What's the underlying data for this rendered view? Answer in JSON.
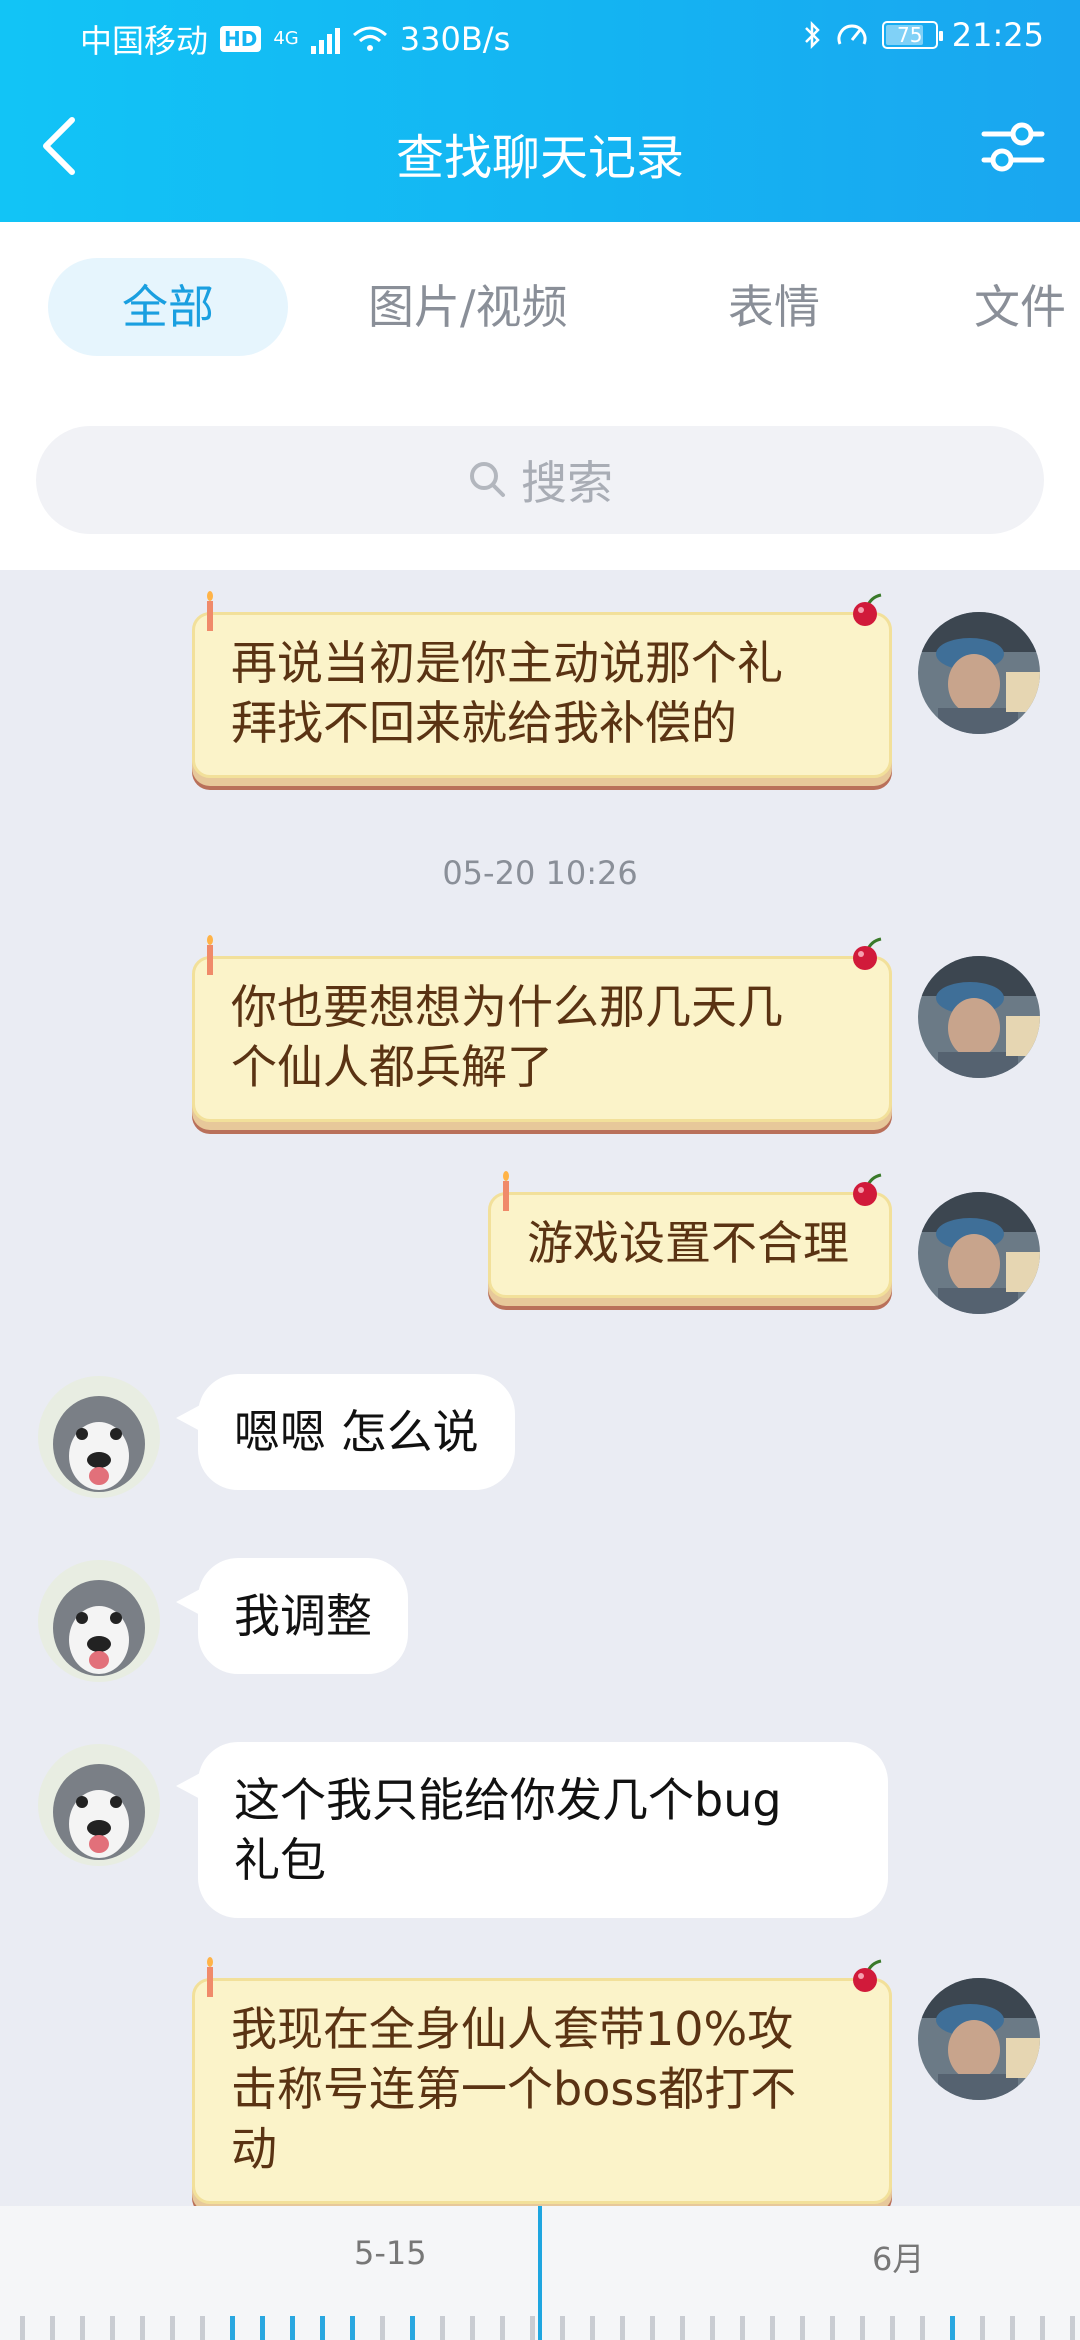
{
  "status_bar": {
    "carrier": "中国移动",
    "hd_badge": "HD",
    "network": "4G",
    "speed": "330B/s",
    "battery": "75",
    "time": "21:25"
  },
  "header": {
    "title": "查找聊天记录",
    "back_icon": "chevron-left-icon",
    "settings_icon": "sliders-icon"
  },
  "tabs": [
    {
      "label": "全部",
      "active": true
    },
    {
      "label": "图片/视频",
      "active": false
    },
    {
      "label": "表情",
      "active": false
    },
    {
      "label": "文件",
      "active": false
    }
  ],
  "search": {
    "placeholder": "搜索"
  },
  "messages": [
    {
      "side": "right",
      "lines": [
        "再说当初是你主动说那个礼",
        "拜找不回来就给我补偿的"
      ]
    },
    {
      "type": "timestamp",
      "text": "05-20 10:26"
    },
    {
      "side": "right",
      "lines": [
        "你也要想想为什么那几天几",
        "个仙人都兵解了"
      ]
    },
    {
      "side": "right",
      "lines": [
        "游戏设置不合理"
      ]
    },
    {
      "side": "left",
      "lines": [
        "嗯嗯 怎么说"
      ]
    },
    {
      "side": "left",
      "lines": [
        "我调整"
      ]
    },
    {
      "side": "left",
      "lines": [
        "这个我只能给你发几个bug",
        "礼包"
      ]
    },
    {
      "side": "right",
      "lines": [
        "我现在全身仙人套带10%攻",
        "击称号连第一个boss都打不",
        "动"
      ]
    }
  ],
  "timeline": {
    "labels": [
      "5-15",
      "6月"
    ]
  },
  "colors": {
    "header_gradient_start": "#12c4f6",
    "header_gradient_end": "#1aa6f0",
    "active_tab": "#1a9fe0",
    "right_bubble": "#fbf3c9",
    "right_text": "#5a3313",
    "background": "#eaecf3"
  }
}
